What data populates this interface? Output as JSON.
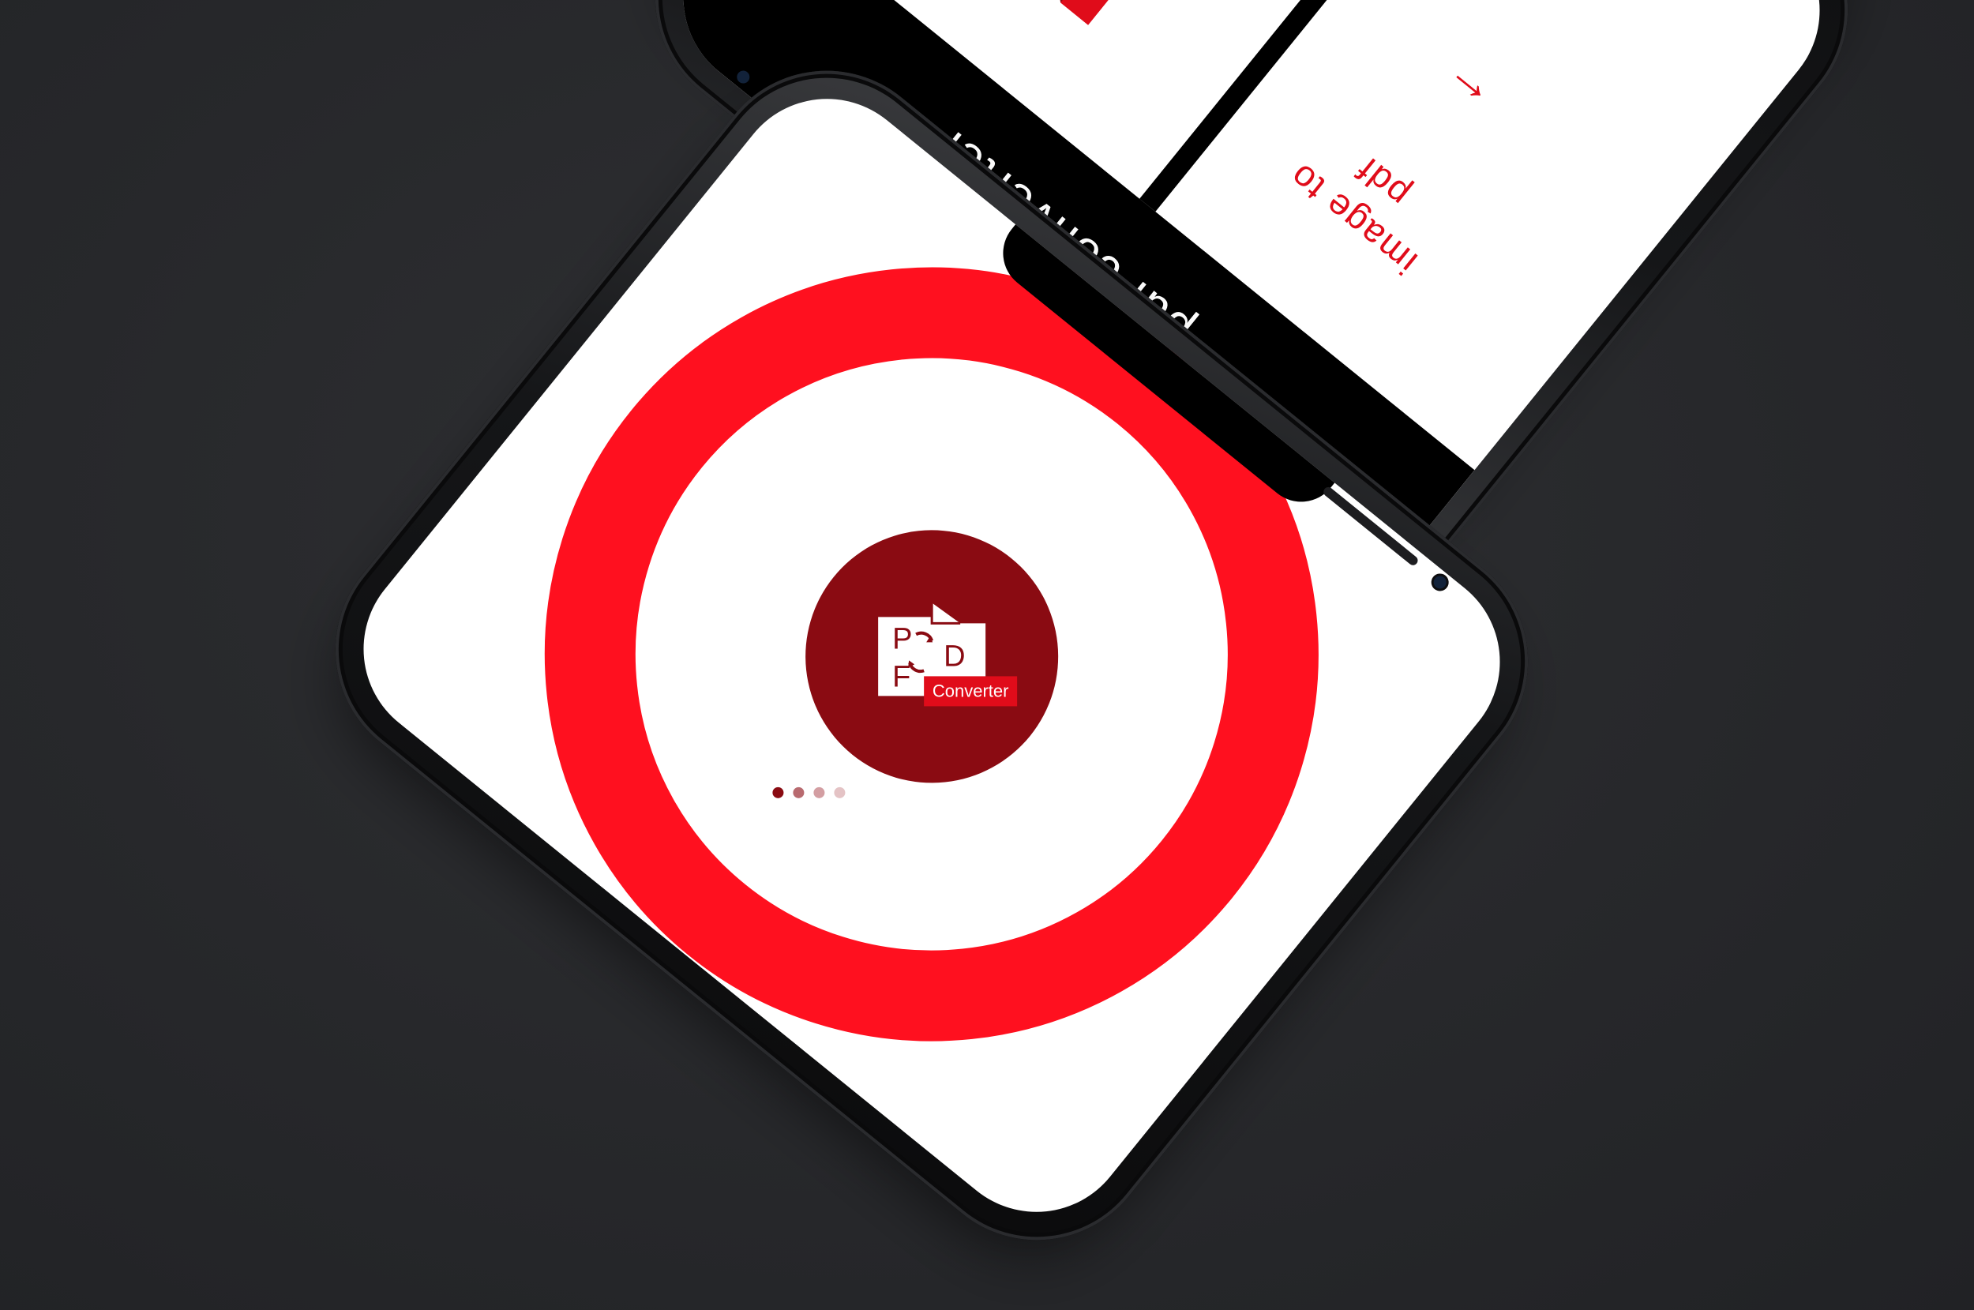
{
  "colors": {
    "background": "#27282b",
    "accent_red": "#ff101f",
    "logo_dark_red": "#8a0b12",
    "text_red": "#e00c1a",
    "device_black": "#0b0b0c",
    "loading_dots": [
      "#8a0b12",
      "#b86a6f",
      "#d39ea2",
      "#e4c3c5"
    ]
  },
  "main_phone": {
    "splash": {
      "logo": {
        "monogram_letters": [
          "P",
          "D",
          "F"
        ],
        "badge_text": "Converter",
        "icon": "pdf-converter-logo-icon"
      },
      "loading_indicator": {
        "dot_count": 4,
        "active_index": 0
      }
    }
  },
  "second_phone": {
    "header_title": "pdf converter",
    "card": {
      "title_line1": "image to",
      "title_line2": "pdf",
      "arrow": "←",
      "icon": "pdf-file-icon"
    }
  }
}
